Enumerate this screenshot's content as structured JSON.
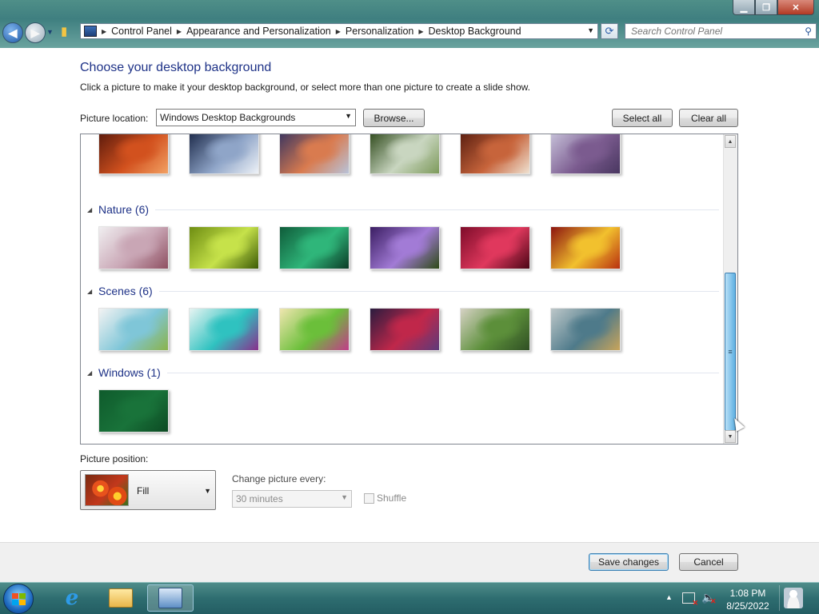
{
  "window": {
    "caption_buttons": {
      "minimize": "▁",
      "maximize": "❐",
      "close": "✕"
    },
    "address": {
      "crumbs": [
        "Control Panel",
        "Appearance and Personalization",
        "Personalization",
        "Desktop Background"
      ],
      "dropdown_icon": "chevron-down-icon",
      "refresh_icon": "refresh-icon"
    },
    "search": {
      "placeholder": "Search Control Panel",
      "icon": "search-icon"
    }
  },
  "page": {
    "title": "Choose your desktop background",
    "description": "Click a picture to make it your desktop background, or select more than one picture to create a slide show."
  },
  "picture_location": {
    "label": "Picture location:",
    "value": "Windows Desktop Backgrounds",
    "browse_label": "Browse...",
    "select_all_label": "Select all",
    "clear_all_label": "Clear all"
  },
  "gallery": {
    "partial_row": {
      "thumbs": [
        {
          "name": "thumb-red-canyon",
          "colors": [
            "#5b1a0c",
            "#d2511e",
            "#f2a163"
          ]
        },
        {
          "name": "thumb-ice-lake",
          "colors": [
            "#1d2a4a",
            "#8fa5c8",
            "#eef2f7"
          ]
        },
        {
          "name": "thumb-sunset-coast",
          "colors": [
            "#3a3560",
            "#d97b4f",
            "#b8c3d9"
          ]
        },
        {
          "name": "thumb-waterfall",
          "colors": [
            "#2f4a1c",
            "#c9d6c0",
            "#7d9a5b"
          ]
        },
        {
          "name": "thumb-rock-arch",
          "colors": [
            "#5a1e10",
            "#c7643b",
            "#efe2d2"
          ]
        },
        {
          "name": "thumb-lavender-field",
          "colors": [
            "#c7c2da",
            "#7b5b8f",
            "#493760"
          ]
        }
      ]
    },
    "groups": [
      {
        "label": "Nature (6)",
        "thumbs": [
          {
            "name": "thumb-pink-spikes",
            "colors": [
              "#f0eef0",
              "#c9a6b5",
              "#8e4f61"
            ]
          },
          {
            "name": "thumb-succulent",
            "colors": [
              "#6e8d12",
              "#c6e24a",
              "#3c5a06"
            ]
          },
          {
            "name": "thumb-green-leaves",
            "colors": [
              "#0f5c3a",
              "#2fb67a",
              "#0a3b26"
            ]
          },
          {
            "name": "thumb-purple-thistle",
            "colors": [
              "#3b1e63",
              "#a27bd6",
              "#2e4a16"
            ]
          },
          {
            "name": "thumb-red-dahlia",
            "colors": [
              "#7e0c2a",
              "#e0385d",
              "#4a0616"
            ]
          },
          {
            "name": "thumb-yellow-petals",
            "colors": [
              "#8c1410",
              "#f2c12e",
              "#b83010"
            ]
          }
        ]
      },
      {
        "label": "Scenes (6)",
        "thumbs": [
          {
            "name": "thumb-scene-1",
            "colors": [
              "#f3f3f3",
              "#7fc6d8",
              "#8bb34a"
            ]
          },
          {
            "name": "thumb-scene-2",
            "colors": [
              "#e8f4f2",
              "#2fc2c0",
              "#8a2f8c"
            ]
          },
          {
            "name": "thumb-scene-3",
            "colors": [
              "#f0e6b0",
              "#6bbf3a",
              "#c23c8a"
            ]
          },
          {
            "name": "thumb-scene-4",
            "colors": [
              "#2a1c3f",
              "#c0274a",
              "#5d3a7a"
            ]
          },
          {
            "name": "thumb-scene-5",
            "colors": [
              "#d6d2c4",
              "#5c8f3a",
              "#2f4f24"
            ]
          },
          {
            "name": "thumb-scene-6",
            "colors": [
              "#bdc7c9",
              "#4e7a8a",
              "#c9a45a"
            ]
          }
        ]
      },
      {
        "label": "Windows (1)",
        "thumbs": [
          {
            "name": "thumb-windows-green",
            "colors": [
              "#0f5b2c",
              "#19733a",
              "#0c4a23"
            ]
          }
        ]
      }
    ],
    "scrollbar_grip": "≡"
  },
  "position": {
    "label": "Picture position:",
    "value": "Fill"
  },
  "slideshow": {
    "change_label": "Change picture every:",
    "interval_value": "30 minutes",
    "shuffle_label": "Shuffle",
    "shuffle_checked": false
  },
  "footer": {
    "save_label": "Save changes",
    "cancel_label": "Cancel"
  },
  "taskbar": {
    "apps": [
      "internet-explorer-icon",
      "windows-explorer-icon",
      "control-panel-icon"
    ],
    "clock_time": "1:08 PM",
    "clock_date": "8/25/2022"
  }
}
